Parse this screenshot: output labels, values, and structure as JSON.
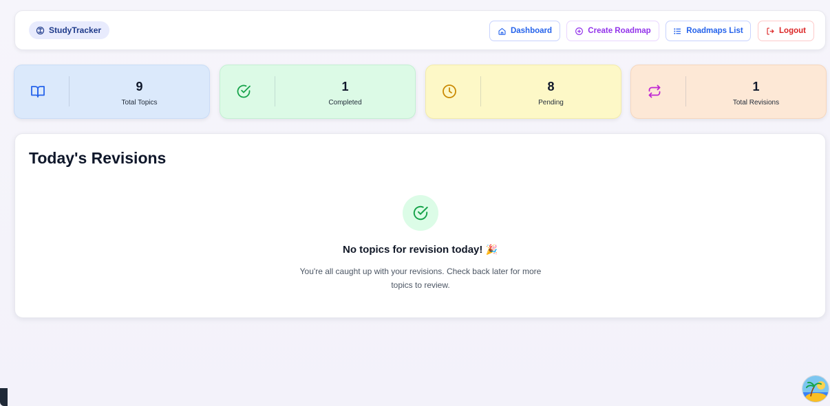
{
  "nav": {
    "brand": "StudyTracker",
    "dashboard": "Dashboard",
    "create_roadmap": "Create Roadmap",
    "roadmaps_list": "Roadmaps List",
    "logout": "Logout"
  },
  "stats": [
    {
      "value": "9",
      "label": "Total Topics",
      "icon": "book-open-icon",
      "color": "#2563eb"
    },
    {
      "value": "1",
      "label": "Completed",
      "icon": "check-circle-icon",
      "color": "#16a34a"
    },
    {
      "value": "8",
      "label": "Pending",
      "icon": "clock-icon",
      "color": "#ca8a04"
    },
    {
      "value": "1",
      "label": "Total Revisions",
      "icon": "repeat-icon",
      "color": "#c026d3"
    }
  ],
  "revisions": {
    "title": "Today's Revisions",
    "empty_heading": "No topics for revision today!",
    "empty_emoji": "🎉",
    "empty_text": "You're all caught up with your revisions. Check back later for more topics to review."
  }
}
